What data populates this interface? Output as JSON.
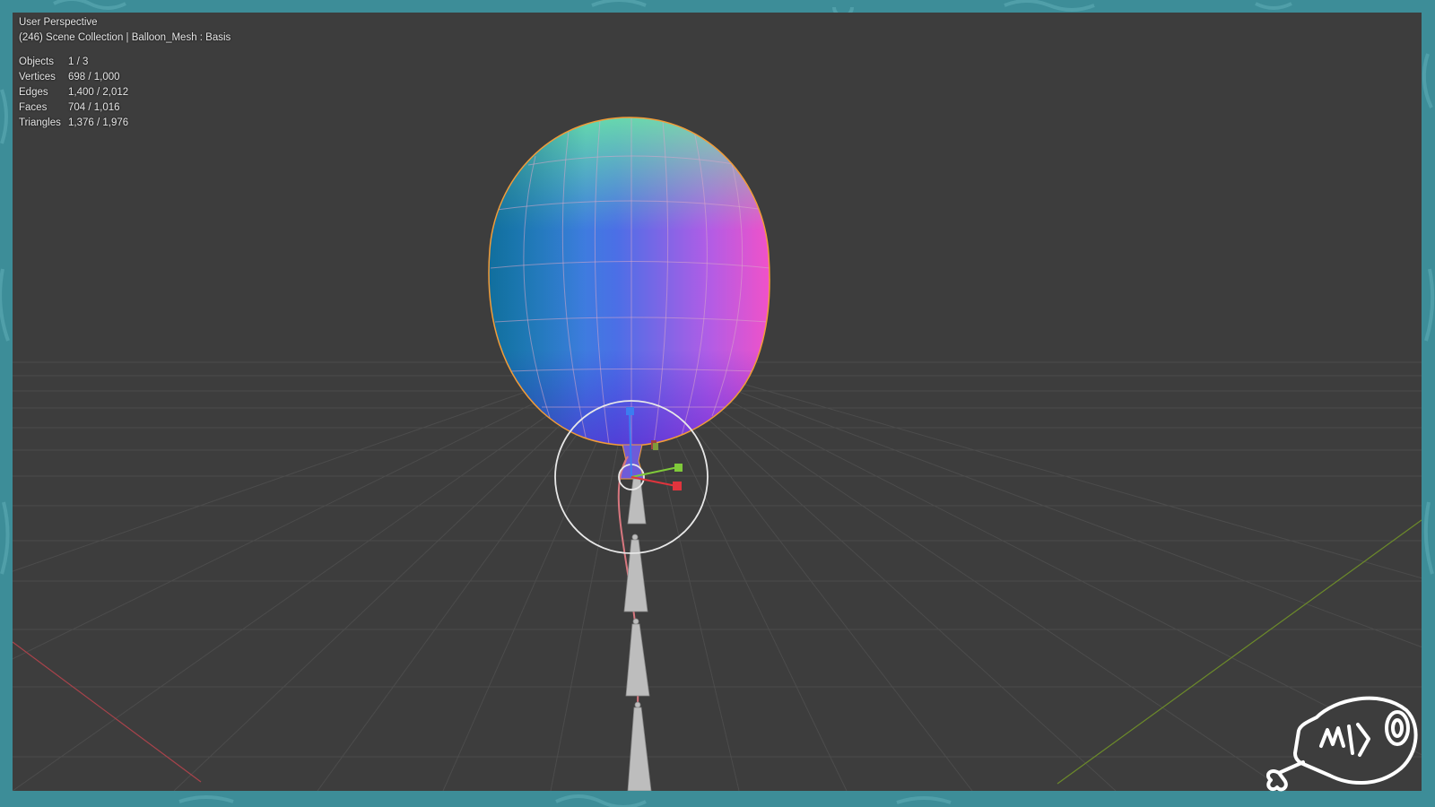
{
  "viewport": {
    "title": "User Perspective",
    "context": "(246) Scene Collection | Balloon_Mesh : Basis"
  },
  "stats": [
    {
      "label": "Objects",
      "value": "1 / 3"
    },
    {
      "label": "Vertices",
      "value": "698 / 1,000"
    },
    {
      "label": "Edges",
      "value": "1,400 / 2,012"
    },
    {
      "label": "Faces",
      "value": "704 / 1,016"
    },
    {
      "label": "Triangles",
      "value": "1,376 / 1,976"
    }
  ],
  "colors": {
    "frame": "#3d8d98",
    "viewport_bg": "#3d3d3d",
    "grid": "#4a4a4a",
    "x_axis": "#a8434b",
    "y_axis": "#6c8a2a",
    "gizmo_z": "#3b7df0",
    "gizmo_y": "#7fc93a",
    "gizmo_x": "#e0343d",
    "selection_outline": "#f29c38"
  },
  "icons": [
    "drumstick-logo-icon",
    "transform-gizmo-icon"
  ]
}
